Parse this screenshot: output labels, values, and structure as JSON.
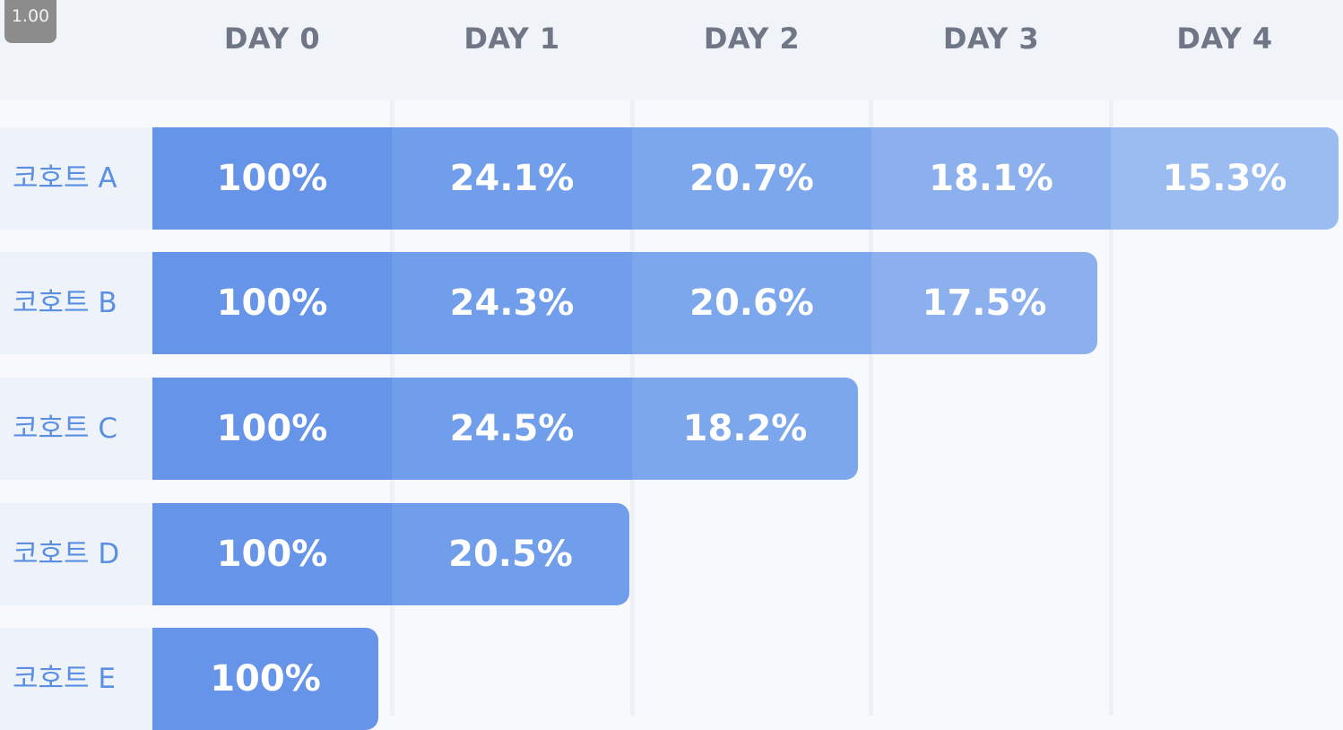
{
  "zoom_label": "1.00",
  "chart_data": {
    "type": "heatmap",
    "columns": [
      "DAY 0",
      "DAY 1",
      "DAY 2",
      "DAY 3",
      "DAY 4"
    ],
    "rows": [
      "코호트 A",
      "코호트 B",
      "코호트 C",
      "코호트 D",
      "코호트 E"
    ],
    "values": [
      [
        100,
        24.1,
        20.7,
        18.1,
        15.3
      ],
      [
        100,
        24.3,
        20.6,
        17.5
      ],
      [
        100,
        24.5,
        18.2
      ],
      [
        100,
        20.5
      ],
      [
        100
      ]
    ],
    "labels": [
      [
        "100%",
        "24.1%",
        "20.7%",
        "18.1%",
        "15.3%"
      ],
      [
        "100%",
        "24.3%",
        "20.6%",
        "17.5%"
      ],
      [
        "100%",
        "24.5%",
        "18.2%"
      ],
      [
        "100%",
        "20.5%"
      ],
      [
        "100%"
      ]
    ],
    "colors": {
      "col0": "#6594e8",
      "col1": "#719eea",
      "col2": "#7ca7ec",
      "col3": "#8cb0ee",
      "col4": "#9bbcf0"
    }
  }
}
